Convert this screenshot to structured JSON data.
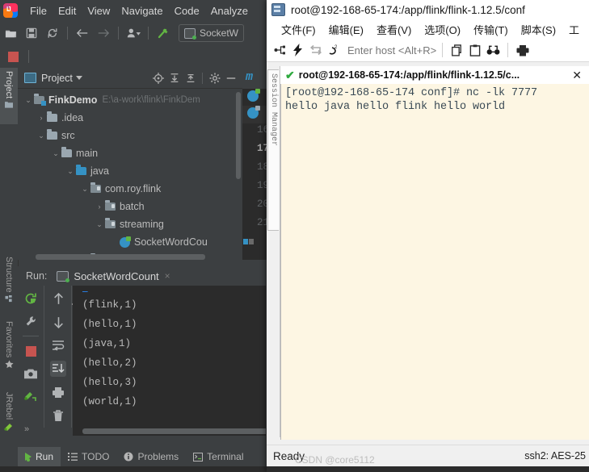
{
  "ide": {
    "menu": [
      "File",
      "Edit",
      "View",
      "Navigate",
      "Code",
      "Analyze"
    ],
    "toolbar": {
      "run_config": "SocketW",
      "icons": [
        "open-folder-icon",
        "save-icon",
        "sync-icon",
        "back-arrow-icon",
        "forward-arrow-icon",
        "vcs-user-icon",
        "build-hammer-icon"
      ]
    },
    "tool_tabs": [
      {
        "label": "Project",
        "icon": "folder-icon",
        "selected": true
      },
      {
        "label": "Structure",
        "icon": "structure-icon",
        "selected": false
      },
      {
        "label": "Favorites",
        "icon": "star-icon",
        "selected": false
      },
      {
        "label": "JRebel",
        "icon": "jrebel-icon",
        "selected": false
      }
    ],
    "project_panel": {
      "title": "Project",
      "header_icons": [
        "locate-icon",
        "expand-all-icon",
        "collapse-all-icon",
        "settings-gear-icon",
        "hide-icon"
      ],
      "tree": [
        {
          "indent": 0,
          "arrow": "⌄",
          "icon": "project-module-icon",
          "name": "FinkDemo",
          "bold": true,
          "path": "E:\\a-work\\flink\\FinkDem"
        },
        {
          "indent": 1,
          "arrow": "›",
          "icon": "folder-icon",
          "name": ".idea",
          "bold": false,
          "path": ""
        },
        {
          "indent": 1,
          "arrow": "⌄",
          "icon": "folder-icon",
          "name": "src",
          "bold": false,
          "path": ""
        },
        {
          "indent": 2,
          "arrow": "⌄",
          "icon": "folder-icon",
          "name": "main",
          "bold": false,
          "path": ""
        },
        {
          "indent": 3,
          "arrow": "⌄",
          "icon": "source-folder-icon",
          "name": "java",
          "bold": false,
          "path": ""
        },
        {
          "indent": 4,
          "arrow": "⌄",
          "icon": "package-icon",
          "name": "com.roy.flink",
          "bold": false,
          "path": ""
        },
        {
          "indent": 5,
          "arrow": "›",
          "icon": "package-icon",
          "name": "batch",
          "bold": false,
          "path": ""
        },
        {
          "indent": 5,
          "arrow": "⌄",
          "icon": "package-icon",
          "name": "streaming",
          "bold": false,
          "path": ""
        },
        {
          "indent": 6,
          "arrow": "",
          "icon": "java-class-icon",
          "name": "SocketWordCou",
          "bold": false,
          "path": ""
        },
        {
          "indent": 4,
          "arrow": "",
          "icon": "folder-icon",
          "name": "resources",
          "bold": false,
          "path": ""
        }
      ]
    },
    "editor": {
      "tab_marker": "m",
      "line_numbers": [
        "16",
        "17",
        "18",
        "19",
        "20",
        "21"
      ],
      "current_line": "17"
    },
    "run_panel": {
      "label": "Run:",
      "tab_title": "SocketWordCount",
      "close_glyph": "×",
      "left_icons": [
        "rerun-icon",
        "settings-wrench-icon",
        "stop-icon",
        "screenshot-camera-icon",
        "jrebel-debug-icon"
      ],
      "mid_icons": [
        "scroll-up-icon",
        "scroll-down-icon",
        "soft-wrap-icon",
        "scroll-to-end-icon",
        "print-icon",
        "trash-icon"
      ],
      "more_glyph": "»",
      "console_lines": [
        "(flink,1)",
        "(hello,1)",
        "(java,1)",
        "(hello,2)",
        "(hello,3)",
        "(world,1)"
      ]
    },
    "status_bar": [
      {
        "label": "Run",
        "icon": "run-play-icon",
        "selected": true
      },
      {
        "label": "TODO",
        "icon": "todo-list-icon",
        "selected": false
      },
      {
        "label": "Problems",
        "icon": "problems-info-icon",
        "selected": false
      },
      {
        "label": "Terminal",
        "icon": "terminal-icon",
        "selected": false
      }
    ]
  },
  "xshell": {
    "title": "root@192-168-65-174:/app/flink/flink-1.12.5/conf",
    "title_icon": "xshell-app-icon",
    "menu": [
      "文件(F)",
      "编辑(E)",
      "查看(V)",
      "选项(O)",
      "传输(T)",
      "脚本(S)",
      "工"
    ],
    "toolbar_icons": [
      "new-session-icon",
      "quick-connect-icon",
      "reconnect-icon",
      "disconnect-icon",
      "copy-session-icon",
      "paste-icon",
      "find-icon",
      "print-icon"
    ],
    "host_placeholder": "Enter host <Alt+R>",
    "session_manager_tab": "Session Manager",
    "tab": {
      "check": "✔",
      "label": "root@192-168-65-174:/app/flink/flink-1.12.5/c...",
      "close": "✕"
    },
    "terminal_lines": [
      "[root@192-168-65-174 conf]# nc -lk 7777",
      "hello java hello flink hello world"
    ],
    "status": {
      "ready": "Ready",
      "encoding": "ssh2: AES-25"
    }
  },
  "watermark": "CSDN @core5112",
  "colors": {
    "ide_bg": "#3c3f41",
    "console_bg": "#2b2b2b",
    "terminal_bg": "#fdf6e3",
    "accent_blue": "#3592c4",
    "green": "#62b543",
    "red": "#c75450"
  }
}
